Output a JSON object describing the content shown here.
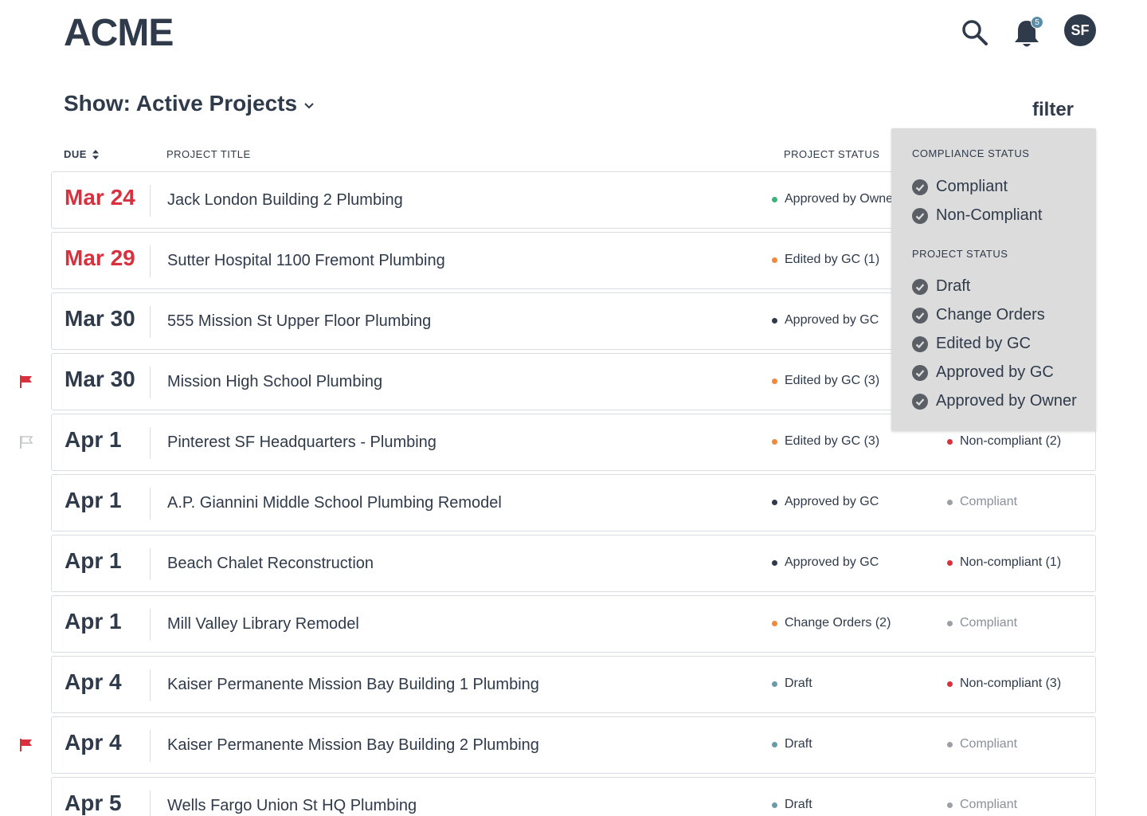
{
  "header": {
    "logo": "ACME",
    "notification_count": "5",
    "avatar_initials": "SF"
  },
  "toolbar": {
    "show_label": "Show: Active Projects",
    "filter_label": "filter"
  },
  "columns": {
    "due": "DUE",
    "title": "PROJECT TITLE",
    "project_status": "PROJECT STATUS"
  },
  "colors": {
    "overdue": "#d9303e",
    "approved_owner": "#3bb27a",
    "edited": "#f08a3a",
    "approved_gc": "#2f3a4a",
    "draft": "#6a9aab",
    "noncompliant": "#d9303e",
    "compliant": "#9aa0a6"
  },
  "rows": [
    {
      "due": "Mar 24",
      "overdue": true,
      "flag": "none",
      "title": "Jack London Building 2 Plumbing",
      "project_status": "Approved by Owner",
      "pcolor": "#3bb27a",
      "compliance": "",
      "ccolor": ""
    },
    {
      "due": "Mar 29",
      "overdue": true,
      "flag": "none",
      "title": "Sutter Hospital 1100 Fremont Plumbing",
      "project_status": "Edited by GC (1)",
      "pcolor": "#f08a3a",
      "compliance": "",
      "ccolor": ""
    },
    {
      "due": "Mar 30",
      "overdue": false,
      "flag": "none",
      "title": "555 Mission St Upper Floor Plumbing",
      "project_status": "Approved by GC",
      "pcolor": "#2f3a4a",
      "compliance": "",
      "ccolor": ""
    },
    {
      "due": "Mar 30",
      "overdue": false,
      "flag": "filled",
      "title": "Mission High School Plumbing",
      "project_status": "Edited by GC (3)",
      "pcolor": "#f08a3a",
      "compliance": "",
      "ccolor": ""
    },
    {
      "due": "Apr 1",
      "overdue": false,
      "flag": "outline",
      "title": "Pinterest SF Headquarters - Plumbing",
      "project_status": "Edited by GC (3)",
      "pcolor": "#f08a3a",
      "compliance": "Non-compliant (2)",
      "ccolor": "#d9303e"
    },
    {
      "due": "Apr 1",
      "overdue": false,
      "flag": "none",
      "title": "A.P. Giannini Middle School Plumbing Remodel",
      "project_status": "Approved by GC",
      "pcolor": "#2f3a4a",
      "compliance": "Compliant",
      "ccolor": "#9aa0a6"
    },
    {
      "due": "Apr 1",
      "overdue": false,
      "flag": "none",
      "title": "Beach Chalet Reconstruction",
      "project_status": "Approved by GC",
      "pcolor": "#2f3a4a",
      "compliance": "Non-compliant (1)",
      "ccolor": "#d9303e"
    },
    {
      "due": "Apr 1",
      "overdue": false,
      "flag": "none",
      "title": "Mill Valley Library Remodel",
      "project_status": "Change Orders (2)",
      "pcolor": "#f08a3a",
      "compliance": "Compliant",
      "ccolor": "#9aa0a6"
    },
    {
      "due": "Apr 4",
      "overdue": false,
      "flag": "none",
      "title": "Kaiser Permanente Mission Bay Building 1 Plumbing",
      "project_status": "Draft",
      "pcolor": "#6a9aab",
      "compliance": "Non-compliant (3)",
      "ccolor": "#d9303e"
    },
    {
      "due": "Apr 4",
      "overdue": false,
      "flag": "filled",
      "title": "Kaiser Permanente Mission Bay Building 2 Plumbing",
      "project_status": "Draft",
      "pcolor": "#6a9aab",
      "compliance": "Compliant",
      "ccolor": "#9aa0a6"
    },
    {
      "due": "Apr 5",
      "overdue": false,
      "flag": "none",
      "title": "Wells Fargo Union St HQ Plumbing",
      "project_status": "Draft",
      "pcolor": "#6a9aab",
      "compliance": "Compliant",
      "ccolor": "#9aa0a6"
    }
  ],
  "filter_panel": {
    "compliance_heading": "COMPLIANCE STATUS",
    "compliance_options": [
      "Compliant",
      "Non-Compliant"
    ],
    "project_heading": "PROJECT STATUS",
    "project_options": [
      "Draft",
      "Change Orders",
      "Edited by GC",
      "Approved by GC",
      "Approved by Owner"
    ]
  }
}
